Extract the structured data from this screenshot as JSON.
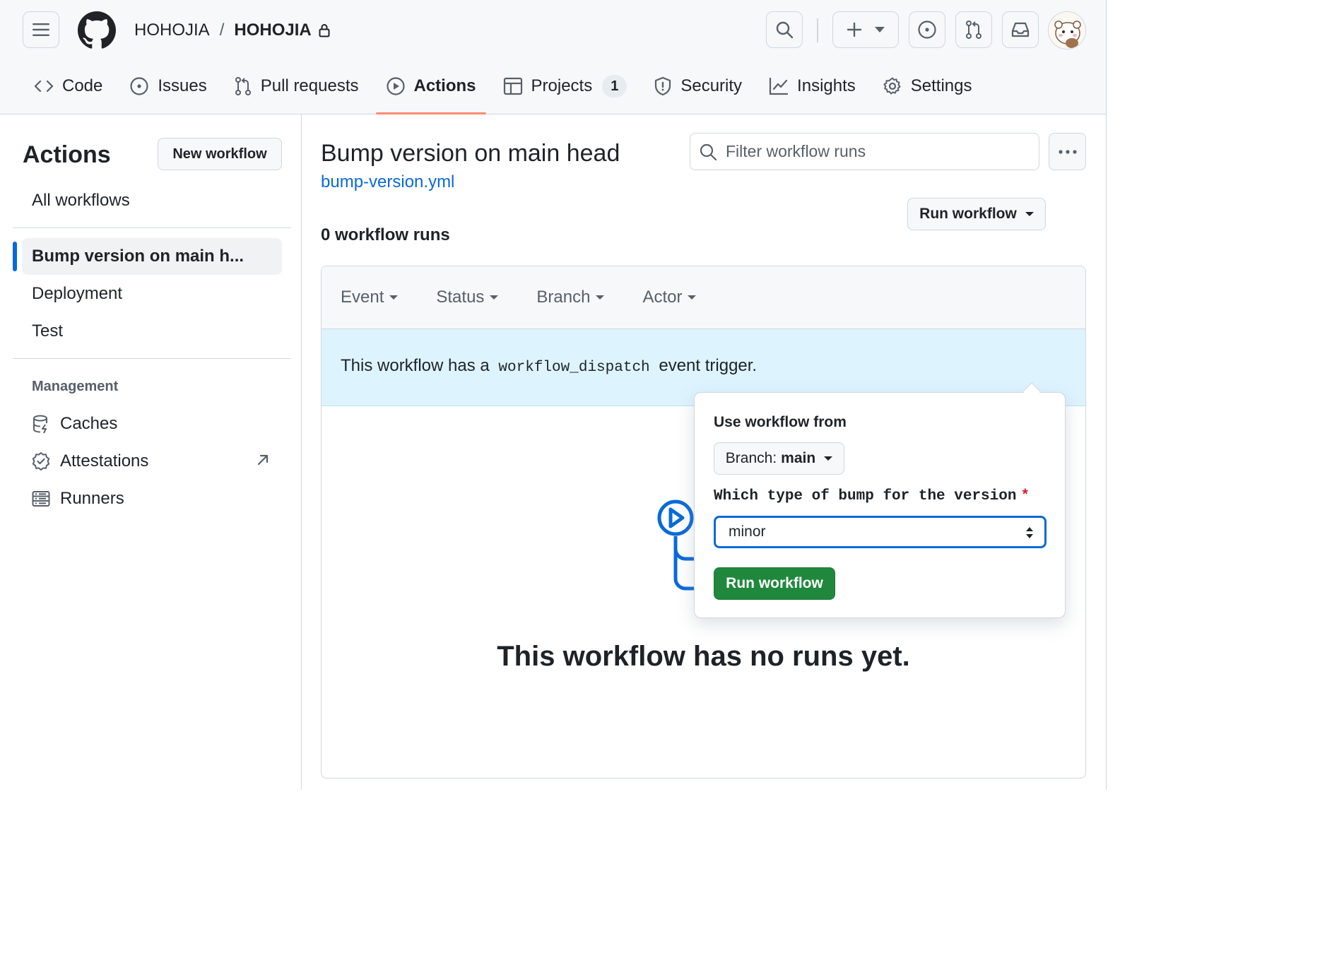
{
  "repo": {
    "owner": "HOHOJIA",
    "separator": "/",
    "name": "HOHOJIA"
  },
  "tabs": [
    {
      "label": "Code",
      "icon": "code-icon"
    },
    {
      "label": "Issues",
      "icon": "issue-opened-icon"
    },
    {
      "label": "Pull requests",
      "icon": "git-pull-request-icon"
    },
    {
      "label": "Actions",
      "icon": "play-icon",
      "active": true
    },
    {
      "label": "Projects",
      "icon": "table-icon",
      "count": "1"
    },
    {
      "label": "Security",
      "icon": "shield-icon"
    },
    {
      "label": "Insights",
      "icon": "graph-icon"
    },
    {
      "label": "Settings",
      "icon": "gear-icon"
    }
  ],
  "sidebar": {
    "title": "Actions",
    "new_workflow": "New workflow",
    "all_workflows": "All workflows",
    "workflows": [
      "Bump version on main h...",
      "Deployment",
      "Test"
    ],
    "management_heading": "Management",
    "management": [
      {
        "label": "Caches",
        "icon": "database-icon"
      },
      {
        "label": "Attestations",
        "icon": "verified-icon"
      },
      {
        "label": "Runners",
        "icon": "server-icon"
      }
    ]
  },
  "main": {
    "title": "Bump version on main head",
    "file": "bump-version.yml",
    "filter_placeholder": "Filter workflow runs",
    "runs_count": "0 workflow runs",
    "filters": [
      "Event",
      "Status",
      "Branch",
      "Actor"
    ],
    "dispatch": {
      "prefix": "This workflow has a",
      "code": "workflow_dispatch",
      "suffix": "event trigger."
    },
    "run_workflow_button": "Run workflow",
    "empty_message": "This workflow has no runs yet."
  },
  "popover": {
    "use_from_label": "Use workflow from",
    "branch_prefix": "Branch:",
    "branch_value": "main",
    "input_label": "Which type of bump for the version",
    "required_mark": "*",
    "input_value": "minor",
    "submit_label": "Run workflow"
  },
  "colors": {
    "accent_blue": "#0969da",
    "active_tab_underline": "#fd8c73",
    "success_green": "#1f883d",
    "dispatch_bg": "#ddf4ff",
    "required_red": "#cf222e"
  }
}
